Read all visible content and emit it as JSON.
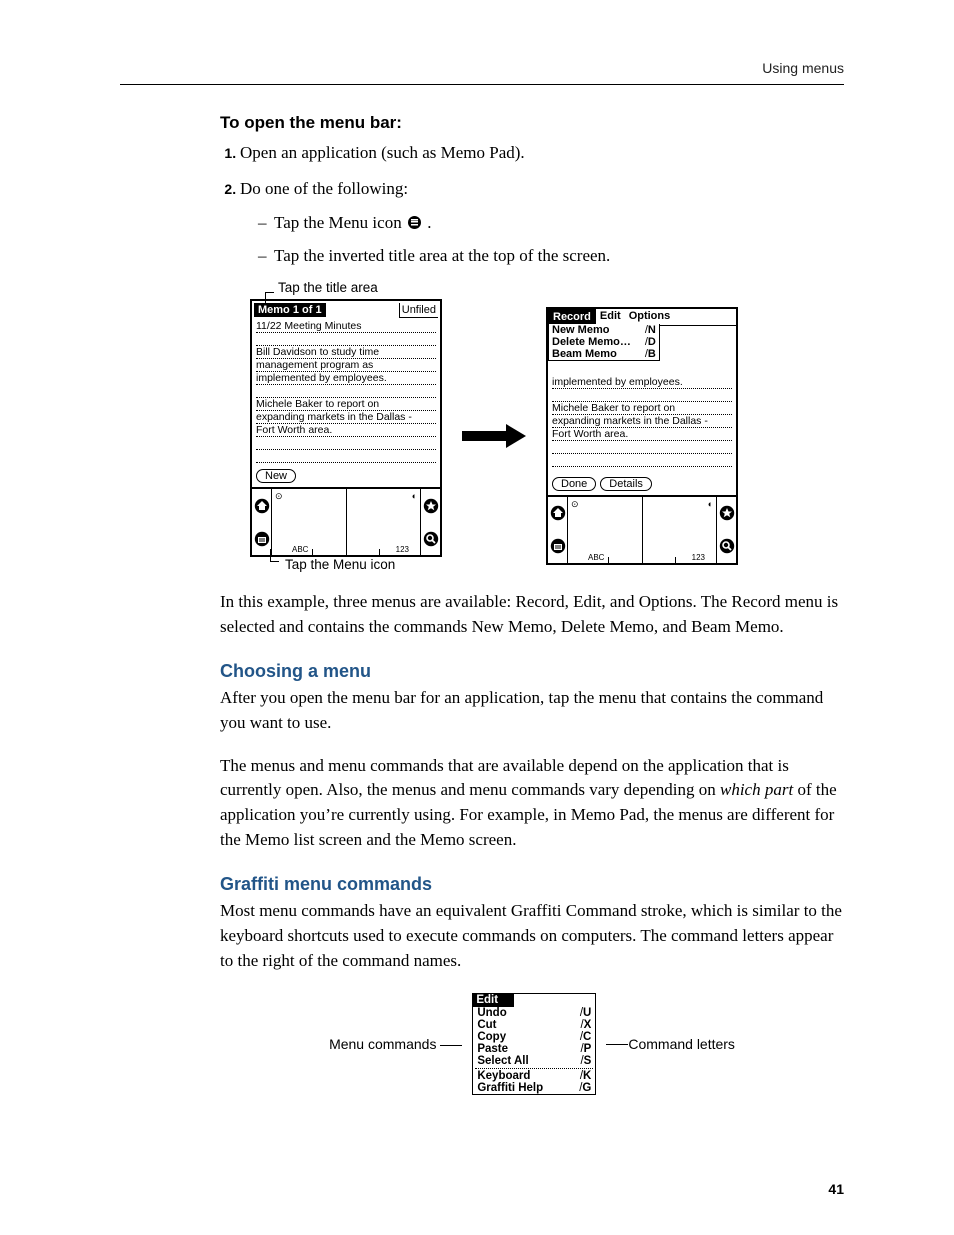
{
  "header": {
    "section": "Using menus"
  },
  "page_number": "41",
  "proc_title": "To open the menu bar:",
  "steps": [
    "Open an application (such as Memo Pad).",
    "Do one of the following:"
  ],
  "sub_steps": [
    "Tap the Menu icon ",
    "Tap the inverted title area at the top of the screen."
  ],
  "callouts": {
    "top": "Tap the title area",
    "bottom": "Tap the Menu icon"
  },
  "palm_left": {
    "title": "Memo 1 of 1",
    "category": "Unfiled",
    "lines": [
      "11/22 Meeting Minutes",
      "",
      "Bill Davidson to study time",
      "management program as",
      "implemented by employees.",
      "",
      "Michele Baker to report on",
      "expanding markets in the Dallas -",
      "Fort Worth area.",
      "",
      ""
    ],
    "buttons": [
      "New"
    ],
    "silk": {
      "abc": "ABC",
      "num": "123"
    }
  },
  "palm_right": {
    "menubar": [
      "Record",
      "Edit",
      "Options"
    ],
    "menu": [
      {
        "label": "New Memo",
        "cmd": "N"
      },
      {
        "label": "Delete Memo…",
        "cmd": "D"
      },
      {
        "label": "Beam Memo",
        "cmd": "B"
      }
    ],
    "lines_below_menu": [
      "implemented by employees.",
      "",
      "Michele Baker to report on",
      "expanding markets in the Dallas -",
      "Fort Worth area.",
      "",
      ""
    ],
    "buttons": [
      "Done",
      "Details"
    ],
    "silk": {
      "abc": "ABC",
      "num": "123"
    }
  },
  "para_after_figure": "In this example, three menus are available: Record, Edit, and Options. The Record menu is selected and contains the commands New Memo, Delete Memo, and Beam Memo.",
  "sec_choosing_title": "Choosing a menu",
  "sec_choosing_p1": "After you open the menu bar for an application, tap the menu that contains the command you want to use.",
  "sec_choosing_p2_a": "The menus and menu commands that are available depend on the application that is currently open. Also, the menus and menu commands vary depending on ",
  "sec_choosing_p2_it": "which part",
  "sec_choosing_p2_b": " of the application you’re currently using. For example, in Memo Pad, the menus are different for the Memo list screen and the Memo screen.",
  "sec_graffiti_title": "Graffiti menu commands",
  "sec_graffiti_p1": "Most menu commands have an equivalent Graffiti Command stroke, which is similar to the keyboard shortcuts used to execute commands on computers. The command letters appear to the right of the command names.",
  "edit_figure": {
    "left_label": "Menu commands",
    "right_label": "Command letters",
    "title": "Edit",
    "rows_top": [
      {
        "label": "Undo",
        "cmd": "U"
      },
      {
        "label": "Cut",
        "cmd": "X"
      },
      {
        "label": "Copy",
        "cmd": "C"
      },
      {
        "label": "Paste",
        "cmd": "P"
      },
      {
        "label": "Select All",
        "cmd": "S"
      }
    ],
    "rows_bot": [
      {
        "label": "Keyboard",
        "cmd": "K"
      },
      {
        "label": "Graffiti Help",
        "cmd": "G"
      }
    ]
  }
}
